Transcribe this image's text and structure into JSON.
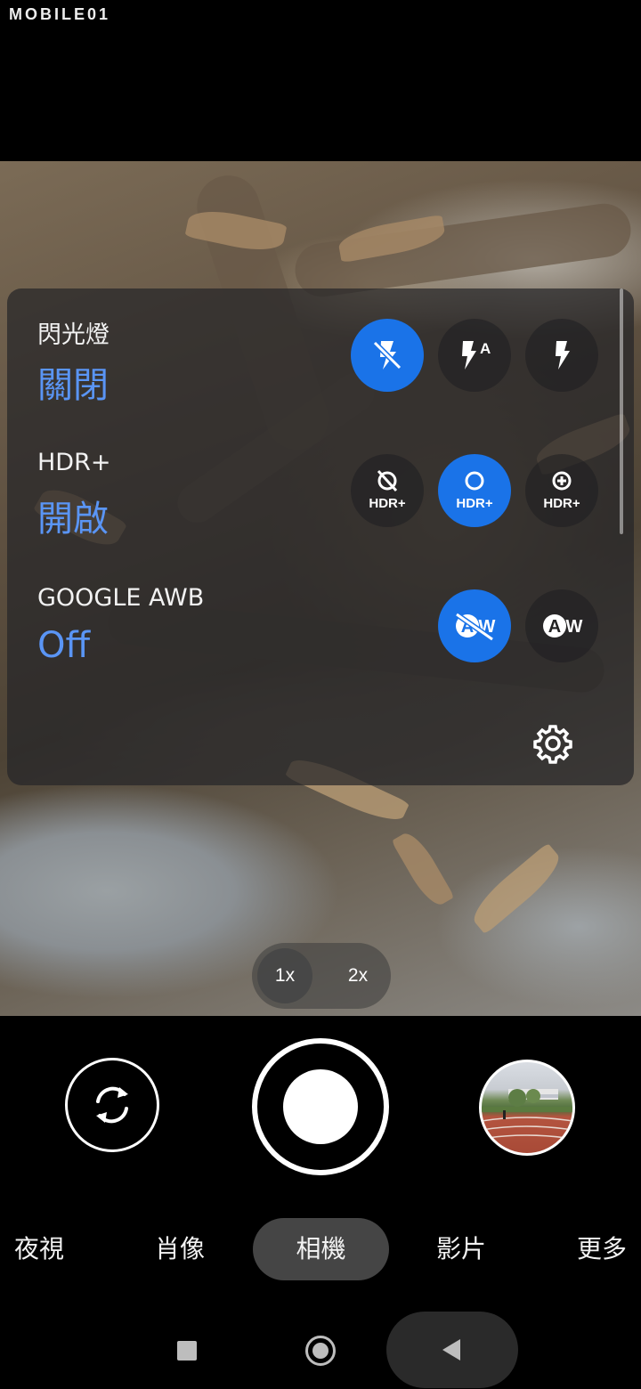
{
  "watermark": "MOBILE01",
  "settings_panel": {
    "flash": {
      "title": "閃光燈",
      "value": "關閉",
      "options": [
        {
          "name": "flash-off",
          "selected": true,
          "badge": ""
        },
        {
          "name": "flash-auto",
          "selected": false,
          "badge": "A"
        },
        {
          "name": "flash-on",
          "selected": false,
          "badge": ""
        }
      ]
    },
    "hdr": {
      "title": "HDR+",
      "value": "開啟",
      "options": [
        {
          "name": "hdr-off",
          "selected": false,
          "label": "HDR+"
        },
        {
          "name": "hdr-on",
          "selected": true,
          "label": "HDR+"
        },
        {
          "name": "hdr-enhanced",
          "selected": false,
          "label": "HDR+"
        }
      ]
    },
    "awb": {
      "title": "GOOGLE AWB",
      "value": "Off",
      "options": [
        {
          "name": "awb-off",
          "selected": true,
          "label": "AW"
        },
        {
          "name": "awb-on",
          "selected": false,
          "label": "AW"
        }
      ]
    }
  },
  "zoom": {
    "options": [
      "1x",
      "2x"
    ],
    "selected": "1x"
  },
  "modes": {
    "items": [
      "夜視",
      "肖像",
      "相機",
      "影片",
      "更多"
    ],
    "selected": "相機"
  },
  "colors": {
    "accent": "#1a73e8",
    "value_text": "#5a95f5"
  }
}
